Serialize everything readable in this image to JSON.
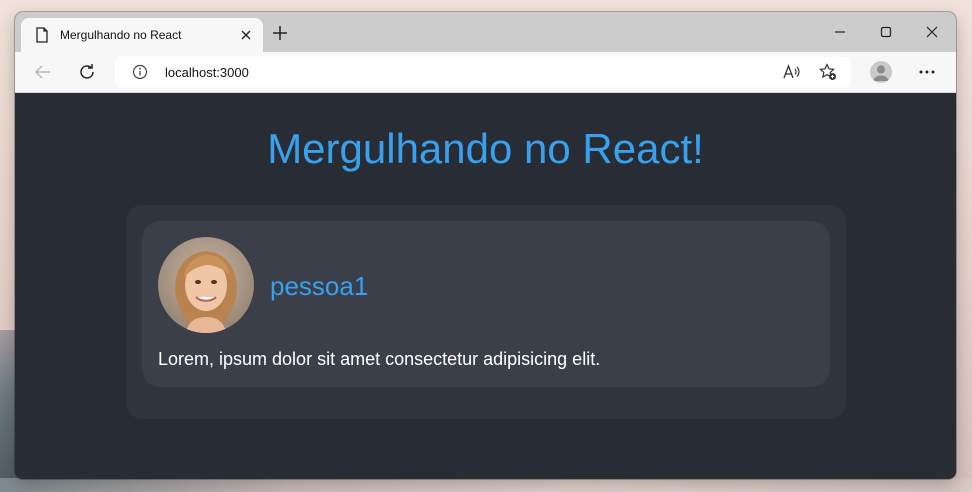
{
  "browser": {
    "tab_title": "Mergulhando no React",
    "url": "localhost:3000",
    "icons": {
      "tab": "page-icon",
      "close": "close-icon",
      "new_tab": "plus-icon",
      "back": "back-arrow-icon",
      "refresh": "refresh-icon",
      "info": "info-icon",
      "read_aloud": "read-aloud-icon",
      "favorite": "favorite-add-icon",
      "profile": "profile-avatar-icon",
      "more": "more-options-icon",
      "minimize": "minimize-icon",
      "maximize": "maximize-icon",
      "window_close": "window-close-icon"
    }
  },
  "page": {
    "title": "Mergulhando no React!",
    "accent_color": "#39a0ed",
    "background_color": "#282c34"
  },
  "posts": [
    {
      "username": "pessoa1",
      "text": "Lorem, ipsum dolor sit amet consectetur adipisicing elit."
    }
  ]
}
